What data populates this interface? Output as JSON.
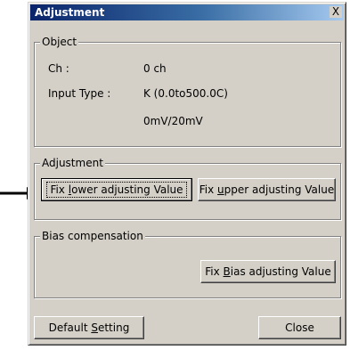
{
  "dialog": {
    "title": "Adjustment",
    "close_glyph": "X"
  },
  "object_group": {
    "legend": "Object",
    "ch_label": "Ch :",
    "ch_value": "0 ch",
    "input_type_label": "Input Type :",
    "input_type_value": "K (0.0to500.0C)",
    "range_value": "0mV/20mV"
  },
  "adjustment_group": {
    "legend": "Adjustment",
    "fix_lower": {
      "pre": "Fix ",
      "key": "l",
      "post": "ower adjusting Value"
    },
    "fix_upper": {
      "pre": "Fix ",
      "key": "u",
      "post": "pper adjusting Value"
    }
  },
  "bias_group": {
    "legend": "Bias compensation",
    "fix_bias": {
      "pre": "Fix ",
      "key": "B",
      "post": "ias adjusting Value"
    }
  },
  "footer": {
    "default_setting": {
      "pre": "Default ",
      "key": "S",
      "post": "etting"
    },
    "close_label": "Close"
  },
  "pointer": {
    "icon": "arrow-right-icon",
    "target": "fix-lower-button"
  }
}
